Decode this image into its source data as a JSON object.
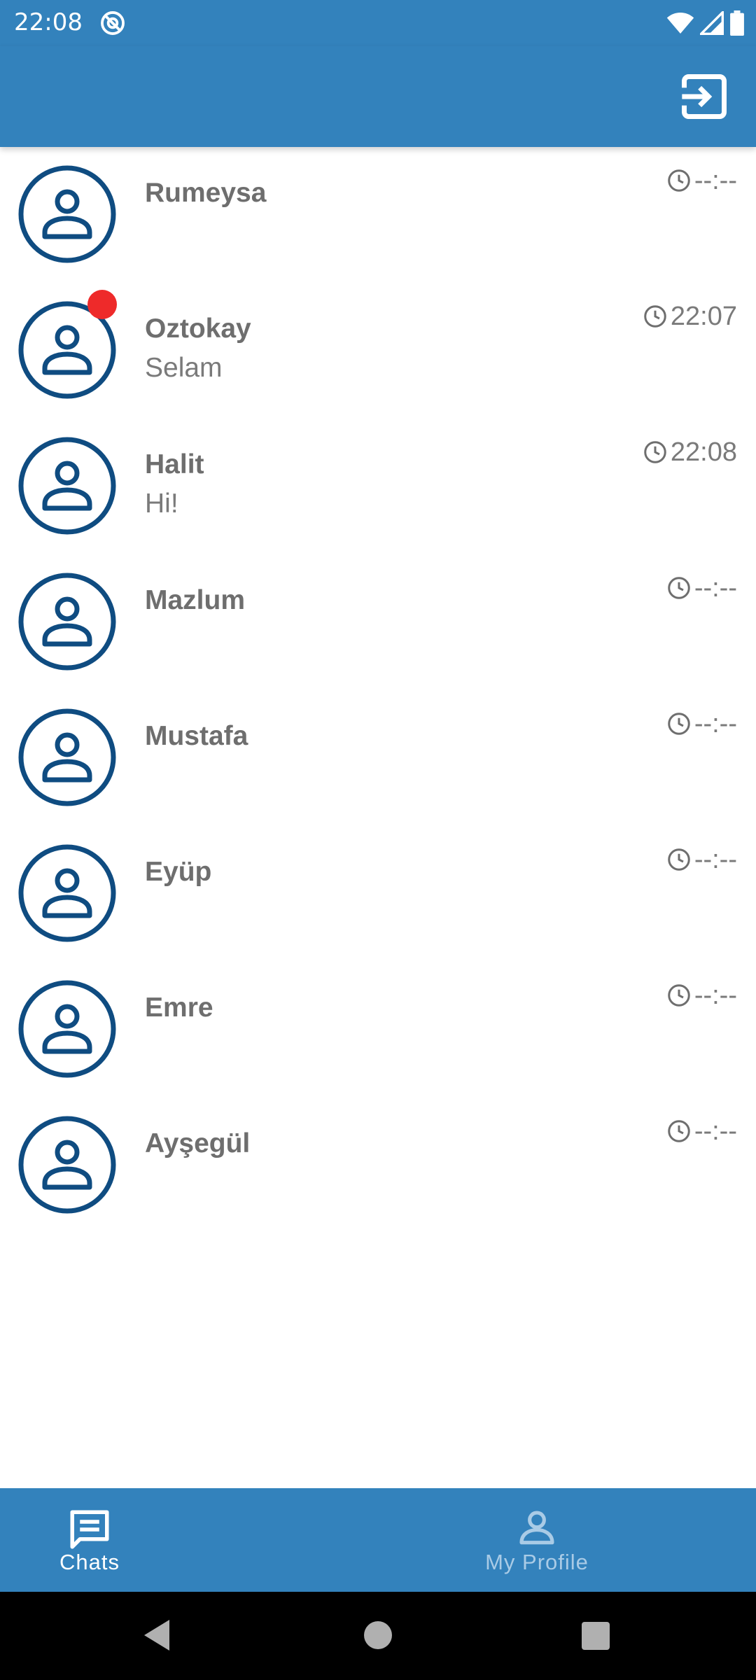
{
  "status_bar": {
    "time": "22:08",
    "icons": [
      "at-sign-icon",
      "wifi-icon",
      "signal-icon",
      "battery-icon"
    ]
  },
  "app_bar": {
    "logout_icon": "logout-icon"
  },
  "chats": [
    {
      "name": "Rumeysa",
      "preview": "",
      "time": "--:--",
      "unread": false
    },
    {
      "name": "Oztokay",
      "preview": "Selam",
      "time": "22:07",
      "unread": false
    },
    {
      "name": "Halit",
      "preview": "Hi!",
      "time": "22:08",
      "unread": true
    },
    {
      "name": "Mazlum",
      "preview": "",
      "time": "--:--",
      "unread": false
    },
    {
      "name": "Mustafa",
      "preview": "",
      "time": "--:--",
      "unread": false
    },
    {
      "name": "Eyüp",
      "preview": "",
      "time": "--:--",
      "unread": false
    },
    {
      "name": "Emre",
      "preview": "",
      "time": "--:--",
      "unread": false
    },
    {
      "name": "Ayşegül",
      "preview": "",
      "time": "--:--",
      "unread": false
    }
  ],
  "bottom_nav": {
    "chats_label": "Chats",
    "profile_label": "My Profile",
    "active": "Chats"
  },
  "colors": {
    "primary": "#3382BC",
    "avatar": "#0F4C81",
    "unread": "#EE2A2A",
    "inactive_nav": "#A9CBE6"
  }
}
